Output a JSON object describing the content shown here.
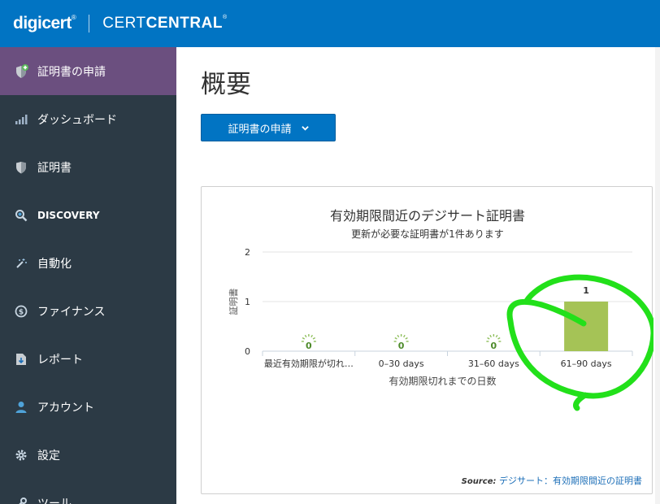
{
  "header": {
    "brand": "digicert",
    "brand_mark": "®",
    "product_light": "CERT",
    "product_bold": "CENTRAL",
    "product_mark": "®"
  },
  "sidebar": {
    "items": [
      {
        "label": "証明書の申請",
        "icon": "shield-plus-icon",
        "active": true
      },
      {
        "label": "ダッシュボード",
        "icon": "bar-chart-icon"
      },
      {
        "label": "証明書",
        "icon": "shield-icon"
      },
      {
        "label": "DISCOVERY",
        "icon": "search-icon"
      },
      {
        "label": "自動化",
        "icon": "magic-wand-icon"
      },
      {
        "label": "ファイナンス",
        "icon": "dollar-icon"
      },
      {
        "label": "レポート",
        "icon": "report-download-icon"
      },
      {
        "label": "アカウント",
        "icon": "user-icon"
      },
      {
        "label": "設定",
        "icon": "gear-icon"
      },
      {
        "label": "ツール",
        "icon": "wrench-icon"
      }
    ]
  },
  "main": {
    "title": "概要",
    "request_button": "証明書の申請",
    "source_label": "Source:",
    "source_link": "デジサート：有効期限間近の証明書"
  },
  "colors": {
    "brand_blue": "#0174c3",
    "sidebar_bg": "#2c3a45",
    "active_item": "#6b4f7f",
    "bar_color": "#a5c356",
    "annotation_green": "#22e01a"
  },
  "chart_data": {
    "type": "bar",
    "title": "有効期限間近のデジサート証明書",
    "subtitle": "更新が必要な証明書が1件あります",
    "categories": [
      "最近有効期限が切れ…",
      "0–30 days",
      "31–60 days",
      "61–90 days"
    ],
    "values": [
      0,
      0,
      0,
      1
    ],
    "xlabel": "有効期限切れまでの日数",
    "ylabel": "証明書",
    "ylim": [
      0,
      2
    ],
    "yticks": [
      "0",
      "1",
      "2"
    ],
    "data_labels": [
      "0",
      "0",
      "0",
      "1"
    ],
    "grid": true,
    "annotation": "green hand-drawn circle around 61–90 days bar"
  }
}
